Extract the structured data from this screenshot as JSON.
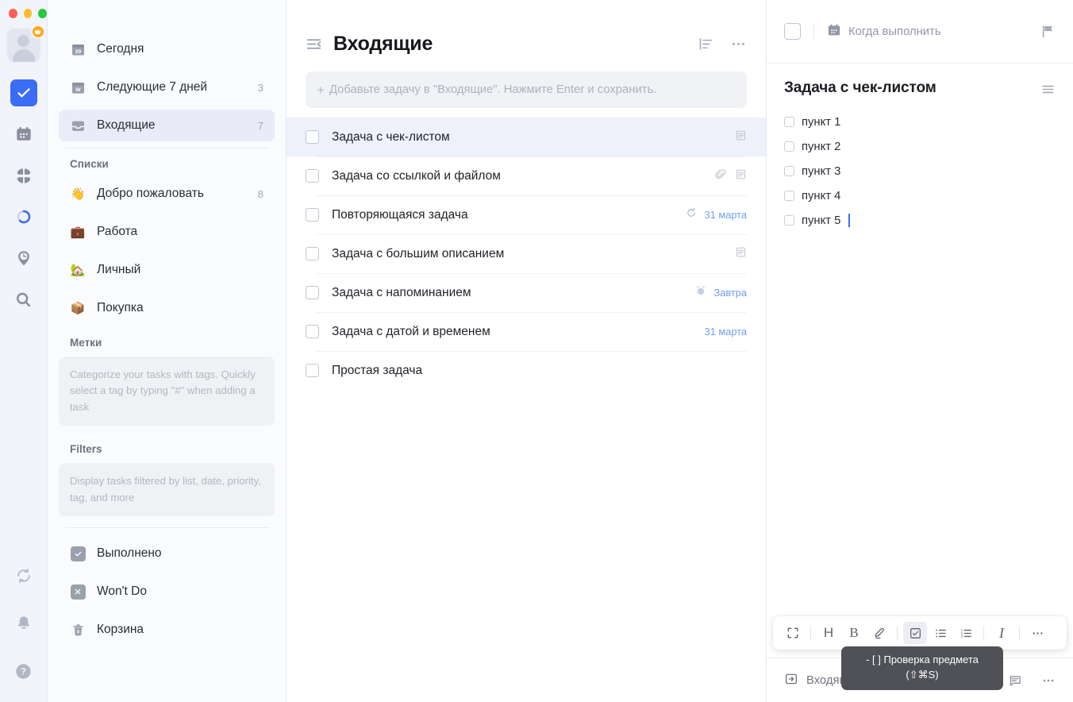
{
  "window": {
    "traffic_lights": [
      "close",
      "minimize",
      "zoom"
    ]
  },
  "rail": {
    "avatar_badge": "♕",
    "items": [
      {
        "name": "tasks",
        "icon": "check-square-icon",
        "glyph": "✔",
        "active": true
      },
      {
        "name": "calendar",
        "icon": "calendar-icon",
        "glyph": "▦",
        "active": false
      },
      {
        "name": "matrix",
        "icon": "four-squares-icon",
        "glyph": "❖",
        "active": false
      },
      {
        "name": "pomodoro",
        "icon": "ring-progress-icon",
        "glyph": "◯",
        "active": false
      },
      {
        "name": "habit-tracker",
        "icon": "clock-pin-icon",
        "glyph": "◔",
        "active": false
      },
      {
        "name": "search",
        "icon": "search-icon",
        "glyph": "⌕",
        "active": false
      }
    ],
    "bottom_items": [
      {
        "name": "sync",
        "icon": "sync-icon"
      },
      {
        "name": "notifications",
        "icon": "bell-icon"
      },
      {
        "name": "help",
        "icon": "question-circle-icon"
      }
    ]
  },
  "sidebar": {
    "smart_lists": [
      {
        "label": "Сегодня",
        "icon": "calendar-29-icon",
        "icon_text": "29",
        "count": ""
      },
      {
        "label": "Следующие 7 дней",
        "icon": "calendar-week-icon",
        "icon_text": "W",
        "count": "3"
      },
      {
        "label": "Входящие",
        "icon": "inbox-icon",
        "icon_text": "",
        "count": "7",
        "selected": true
      }
    ],
    "lists_title": "Списки",
    "lists": [
      {
        "label": "Добро пожаловать",
        "emoji": "👋",
        "count": "8"
      },
      {
        "label": "Работа",
        "emoji": "💼",
        "count": ""
      },
      {
        "label": "Личный",
        "emoji": "🏡",
        "count": ""
      },
      {
        "label": "Покупка",
        "emoji": "📦",
        "count": ""
      }
    ],
    "tags_title": "Метки",
    "tags_hint": "Categorize your tasks with tags. Quickly select a tag by typing \"#\" when adding a task",
    "filters_title": "Filters",
    "filters_hint": "Display tasks filtered by list, date, priority, tag, and more",
    "footer_items": [
      {
        "label": "Выполнено",
        "icon": "check-box-icon",
        "glyph": "✓"
      },
      {
        "label": "Won't Do",
        "icon": "x-box-icon",
        "glyph": "✕"
      },
      {
        "label": "Корзина",
        "icon": "trash-icon",
        "glyph": "🗑"
      }
    ]
  },
  "main": {
    "title": "Входящие",
    "collapse_icon": "collapse-sidebar-icon",
    "sort_icon": "sort-icon",
    "more_icon": "more-horizontal-icon",
    "add_task_placeholder": "Добавьте задачу в \"Входящие\". Нажмите Enter и сохранить.",
    "tasks": [
      {
        "title": "Задача с чек-листом",
        "date": "",
        "selected": true,
        "icons": [
          "description-icon"
        ]
      },
      {
        "title": "Задача со ссылкой и файлом",
        "date": "",
        "selected": false,
        "icons": [
          "paperclip-icon",
          "description-icon"
        ]
      },
      {
        "title": "Повторяющаяся задача",
        "date": "31 марта",
        "selected": false,
        "icons": [
          "repeat-icon"
        ]
      },
      {
        "title": "Задача с большим описанием",
        "date": "",
        "selected": false,
        "icons": [
          "description-icon"
        ]
      },
      {
        "title": "Задача с напоминанием",
        "date": "Завтра",
        "selected": false,
        "icons": [
          "alarm-icon"
        ]
      },
      {
        "title": "Задача с датой и временем",
        "date": "31 марта",
        "selected": false,
        "icons": []
      },
      {
        "title": "Простая задача",
        "date": "",
        "selected": false,
        "icons": []
      }
    ]
  },
  "detail": {
    "due_label": "Когда выполнить",
    "due_icon": "calendar-icon",
    "flag_icon": "flag-icon",
    "menu_icon": "hamburger-icon",
    "title": "Задача с чек-листом",
    "checklist": [
      {
        "label": "пункт 1",
        "checked": false
      },
      {
        "label": "пункт 2",
        "checked": false
      },
      {
        "label": "пункт 3",
        "checked": false
      },
      {
        "label": "пункт 4",
        "checked": false
      },
      {
        "label": "пункт 5",
        "checked": false,
        "caret": true
      }
    ],
    "toolbar": [
      {
        "name": "fullscreen-icon",
        "label": "⛶",
        "active": false
      },
      {
        "sep": true
      },
      {
        "name": "heading-icon",
        "label": "H",
        "active": false
      },
      {
        "name": "bold-icon",
        "label": "B",
        "active": false
      },
      {
        "name": "highlight-icon",
        "label": "🖊",
        "active": false
      },
      {
        "sep": true
      },
      {
        "name": "checklist-icon",
        "label": "☑",
        "active": true
      },
      {
        "name": "bullet-list-icon",
        "label": "☰",
        "active": false
      },
      {
        "name": "numbered-list-icon",
        "label": "☷",
        "active": false
      },
      {
        "sep": true
      },
      {
        "name": "italic-icon",
        "label": "I",
        "active": false
      },
      {
        "sep": true
      },
      {
        "name": "more-horizontal-icon",
        "label": "⋯",
        "active": false
      }
    ],
    "tooltip_line1": "- [ ] Проверка предмета",
    "tooltip_line2": "(⇧⌘S)",
    "footer_list_label": "Входящие",
    "footer_list_icon": "move-to-list-icon",
    "footer_font_icon": "font-size-icon",
    "footer_comment_icon": "comment-icon",
    "footer_more_icon": "more-horizontal-icon"
  },
  "colors": {
    "accent": "#3b6cf6",
    "date_blue": "#6f9ef0",
    "selected_row": "#eef1fb",
    "sidebar_bg": "#fafbfd",
    "rail_bg": "#f2f4fb",
    "tooltip_bg": "#4f5157"
  }
}
